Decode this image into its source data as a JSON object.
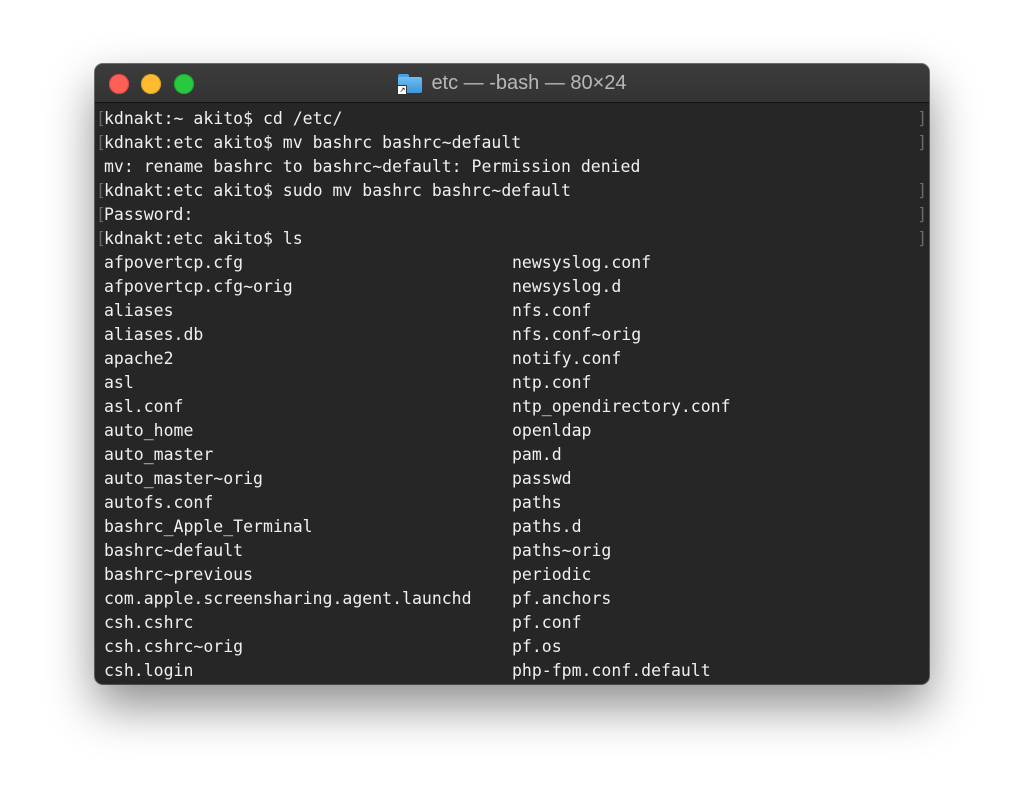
{
  "window": {
    "title": "etc — -bash — 80×24",
    "folder_icon": "folder-icon"
  },
  "terminal": {
    "lines": [
      "kdnakt:~ akito$ cd /etc/",
      "kdnakt:etc akito$ mv bashrc bashrc~default",
      "mv: rename bashrc to bashrc~default: Permission denied",
      "kdnakt:etc akito$ sudo mv bashrc bashrc~default",
      "Password:",
      "kdnakt:etc akito$ ls"
    ],
    "ls_left": [
      "afpovertcp.cfg",
      "afpovertcp.cfg~orig",
      "aliases",
      "aliases.db",
      "apache2",
      "asl",
      "asl.conf",
      "auto_home",
      "auto_master",
      "auto_master~orig",
      "autofs.conf",
      "bashrc_Apple_Terminal",
      "bashrc~default",
      "bashrc~previous",
      "com.apple.screensharing.agent.launchd",
      "csh.cshrc",
      "csh.cshrc~orig",
      "csh.login"
    ],
    "ls_right": [
      "newsyslog.conf",
      "newsyslog.d",
      "nfs.conf",
      "nfs.conf~orig",
      "notify.conf",
      "ntp.conf",
      "ntp_opendirectory.conf",
      "openldap",
      "pam.d",
      "passwd",
      "paths",
      "paths.d",
      "paths~orig",
      "periodic",
      "pf.anchors",
      "pf.conf",
      "pf.os",
      "php-fpm.conf.default"
    ]
  }
}
